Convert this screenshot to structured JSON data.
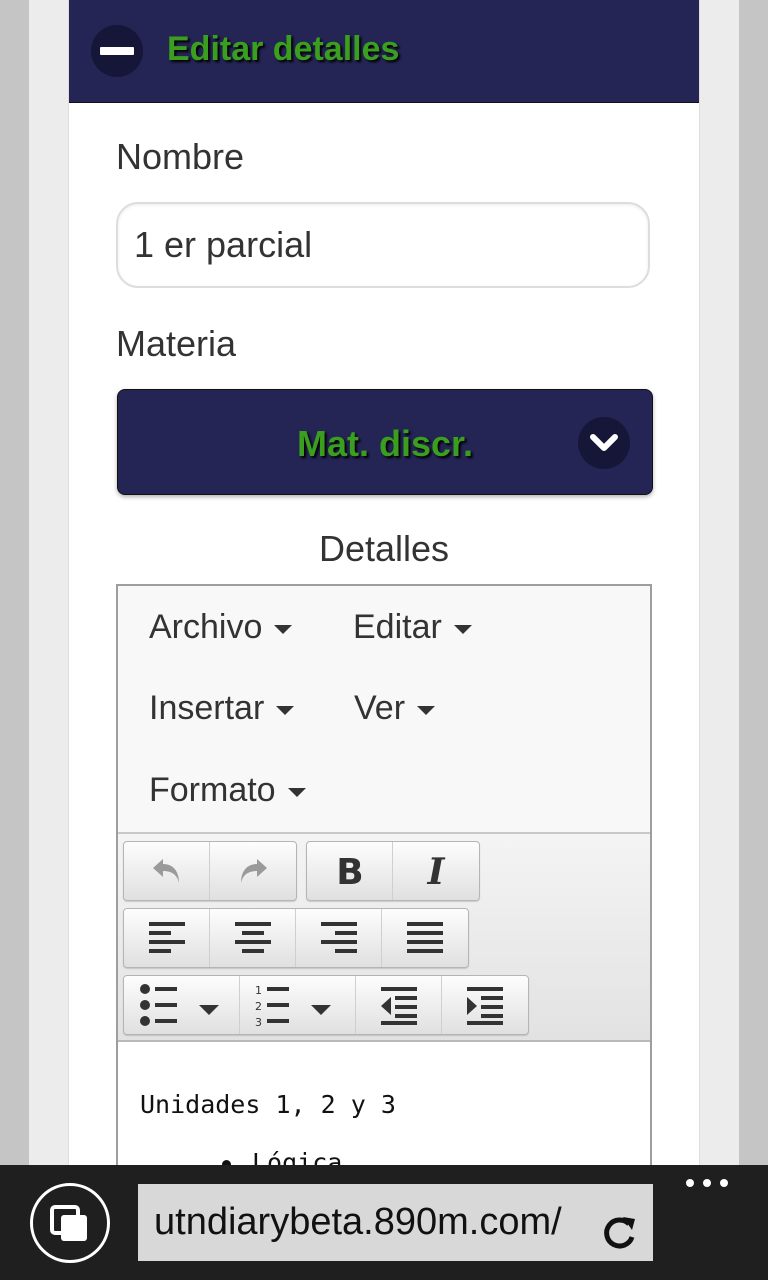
{
  "header": {
    "title": "Editar detalles"
  },
  "form": {
    "name_label": "Nombre",
    "name_value": "1 er parcial",
    "subject_label": "Materia",
    "subject_value": "Mat. discr.",
    "details_label": "Detalles"
  },
  "editor": {
    "menu": [
      "Archivo",
      "Editar",
      "Insertar",
      "Ver",
      "Formato"
    ],
    "toolbar_icons": [
      "undo-icon",
      "redo-icon",
      "bold-icon",
      "italic-icon",
      "align-left-icon",
      "align-center-icon",
      "align-right-icon",
      "align-justify-icon",
      "bullet-list-icon",
      "numbered-list-icon",
      "outdent-icon",
      "indent-icon"
    ],
    "content_line": "Unidades 1, 2 y 3",
    "bullet": "Lógica"
  },
  "browser": {
    "url": "utndiarybeta.890m.com/"
  },
  "colors": {
    "header_bg": "#242455",
    "title_green": "#3a9e1f"
  }
}
